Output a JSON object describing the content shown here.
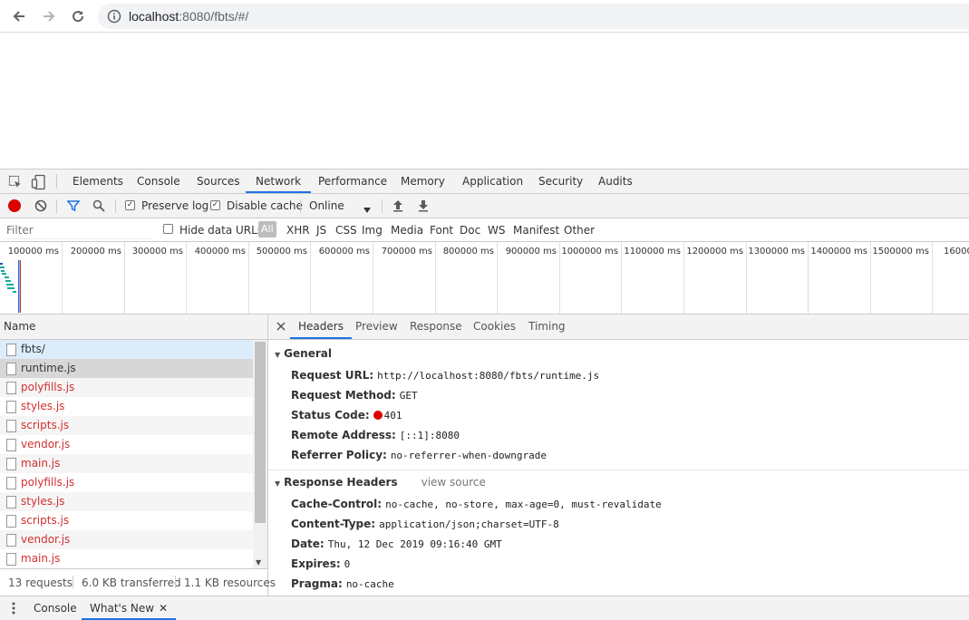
{
  "browser": {
    "url_host": "localhost",
    "url_rest": ":8080/fbts/#/"
  },
  "devtools": {
    "tabs": [
      "Elements",
      "Console",
      "Sources",
      "Network",
      "Performance",
      "Memory",
      "Application",
      "Security",
      "Audits"
    ],
    "active_tab": "Network"
  },
  "toolbar": {
    "preserve_log": "Preserve log",
    "disable_cache": "Disable cache",
    "throttle": "Online"
  },
  "filter": {
    "placeholder": "Filter",
    "hide_data_urls": "Hide data URLs",
    "types": [
      "All",
      "XHR",
      "JS",
      "CSS",
      "Img",
      "Media",
      "Font",
      "Doc",
      "WS",
      "Manifest",
      "Other"
    ]
  },
  "timeline": {
    "ticks": [
      "100000 ms",
      "200000 ms",
      "300000 ms",
      "400000 ms",
      "500000 ms",
      "600000 ms",
      "700000 ms",
      "800000 ms",
      "900000 ms",
      "1000000 ms",
      "1100000 ms",
      "1200000 ms",
      "1300000 ms",
      "1400000 ms",
      "1500000 ms",
      "16000"
    ]
  },
  "requests": {
    "column": "Name",
    "items": [
      {
        "name": "fbts/",
        "error": false
      },
      {
        "name": "runtime.js",
        "error": false
      },
      {
        "name": "polyfills.js",
        "error": true
      },
      {
        "name": "styles.js",
        "error": true
      },
      {
        "name": "scripts.js",
        "error": true
      },
      {
        "name": "vendor.js",
        "error": true
      },
      {
        "name": "main.js",
        "error": true
      },
      {
        "name": "polyfills.js",
        "error": true
      },
      {
        "name": "styles.js",
        "error": true
      },
      {
        "name": "scripts.js",
        "error": true
      },
      {
        "name": "vendor.js",
        "error": true
      },
      {
        "name": "main.js",
        "error": true
      }
    ],
    "status": {
      "requests": "13 requests",
      "transferred": "6.0 KB transferred",
      "resources": "1.1 KB resources"
    }
  },
  "detail": {
    "tabs": [
      "Headers",
      "Preview",
      "Response",
      "Cookies",
      "Timing"
    ],
    "active_tab": "Headers",
    "general": {
      "title": "General",
      "rows": [
        {
          "k": "Request URL:",
          "v": "http://localhost:8080/fbts/runtime.js"
        },
        {
          "k": "Request Method:",
          "v": "GET"
        },
        {
          "k": "Status Code:",
          "v": "401"
        },
        {
          "k": "Remote Address:",
          "v": "[::1]:8080"
        },
        {
          "k": "Referrer Policy:",
          "v": "no-referrer-when-downgrade"
        }
      ]
    },
    "response_headers": {
      "title": "Response Headers",
      "view_source": "view source",
      "rows": [
        {
          "k": "Cache-Control:",
          "v": "no-cache, no-store, max-age=0, must-revalidate"
        },
        {
          "k": "Content-Type:",
          "v": "application/json;charset=UTF-8"
        },
        {
          "k": "Date:",
          "v": "Thu, 12 Dec 2019 09:16:40 GMT"
        },
        {
          "k": "Expires:",
          "v": "0"
        },
        {
          "k": "Pragma:",
          "v": "no-cache"
        }
      ]
    }
  },
  "drawer": {
    "tabs": [
      "Console",
      "What's New"
    ],
    "active_tab": "What's New"
  },
  "colors": {
    "accent": "#1a73e8",
    "error": "#d32f2f",
    "status_dot": "#dd0000"
  }
}
